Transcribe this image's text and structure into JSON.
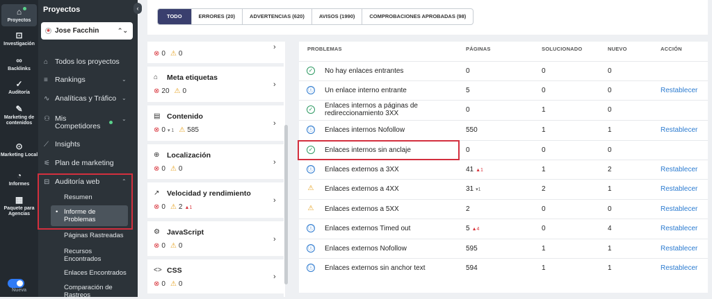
{
  "rail": [
    {
      "label": "Proyectos",
      "icon": "home-icon",
      "glyph": "⌂",
      "active": true
    },
    {
      "label": "Investigación",
      "icon": "research-icon",
      "glyph": "⊡"
    },
    {
      "label": "Backlinks",
      "icon": "link-icon",
      "glyph": "∞"
    },
    {
      "label": "Auditoría",
      "icon": "audit-icon",
      "glyph": "✓"
    },
    {
      "label": "Marketing de contenidos",
      "icon": "edit-icon",
      "glyph": "✎"
    },
    {
      "label": "Marketing Local",
      "icon": "location-icon",
      "glyph": "⊙"
    },
    {
      "label": "Informes",
      "icon": "chart-icon",
      "glyph": "◔"
    },
    {
      "label": "Paquete para Agencias",
      "icon": "building-icon",
      "glyph": "▦"
    },
    {
      "label": "Nueva",
      "icon": "toggle-icon",
      "glyph": ""
    }
  ],
  "sidebar": {
    "title": "Proyectos",
    "project": "Jose Facchin",
    "items": [
      {
        "label": "Todos los proyectos",
        "icon": "folder-icon",
        "glyph": "⌂"
      },
      {
        "label": "Rankings",
        "icon": "rankings-icon",
        "glyph": "≡",
        "caret": "⌄"
      },
      {
        "label": "Analíticas y Tráfico",
        "icon": "analytics-icon",
        "glyph": "∿",
        "caret": "⌄"
      },
      {
        "label": "Mis Competidores",
        "icon": "competitors-icon",
        "glyph": "⚇",
        "caret": "⌄"
      },
      {
        "label": "Insights",
        "icon": "insights-icon",
        "glyph": "⟋"
      },
      {
        "label": "Plan de marketing",
        "icon": "plan-icon",
        "glyph": "⚟"
      },
      {
        "label": "Auditoría web",
        "icon": "webaudit-icon",
        "glyph": "⊟",
        "caret": "⌃"
      }
    ],
    "subitems": [
      "Resumen",
      "Informe de Problemas",
      "Páginas Rastreadas",
      "Recursos Encontrados",
      "Enlaces Encontrados",
      "Comparación de Rastreos"
    ]
  },
  "tabs": [
    "TODO",
    "ERRORES (20)",
    "ADVERTENCIAS (620)",
    "AVISOS (1990)",
    "COMPROBACIONES APROBADAS (98)"
  ],
  "categories": [
    {
      "title": "",
      "icon": "",
      "err": "0",
      "warn": "0"
    },
    {
      "title": "Meta etiquetas",
      "icon": "tag-icon",
      "glyph": "⌂",
      "err": "20",
      "warn": "0"
    },
    {
      "title": "Contenido",
      "icon": "document-icon",
      "glyph": "▤",
      "err": "0",
      "errtrend": "▾ 1",
      "warn": "585"
    },
    {
      "title": "Localización",
      "icon": "globe-icon",
      "glyph": "⊕",
      "err": "0",
      "warn": "0"
    },
    {
      "title": "Velocidad y rendimiento",
      "icon": "speed-icon",
      "glyph": "↗",
      "err": "0",
      "warn": "2",
      "warntrend": "▲1"
    },
    {
      "title": "JavaScript",
      "icon": "javascript-icon",
      "glyph": "⚙",
      "err": "0",
      "warn": "0"
    },
    {
      "title": "CSS",
      "icon": "code-icon",
      "glyph": "<>",
      "err": "0",
      "warn": "0"
    }
  ],
  "table": {
    "headers": [
      "PROBLEMAS",
      "PÁGINAS",
      "SOLUCIONADO",
      "NUEVO",
      "ACCIÓN"
    ],
    "rows": [
      {
        "type": "ok",
        "name": "No hay enlaces entrantes",
        "pages": "0",
        "fixed": "0",
        "new": "0",
        "action": ""
      },
      {
        "type": "info",
        "name": "Un enlace interno entrante",
        "pages": "5",
        "fixed": "0",
        "new": "0",
        "action": "Restablecer"
      },
      {
        "type": "ok",
        "name": "Enlaces internos a páginas de redireccionamiento 3XX",
        "pages": "0",
        "fixed": "1",
        "new": "0",
        "action": ""
      },
      {
        "type": "info",
        "name": "Enlaces internos Nofollow",
        "pages": "550",
        "fixed": "1",
        "new": "1",
        "action": "Restablecer"
      },
      {
        "type": "ok",
        "name": "Enlaces internos sin anclaje",
        "pages": "0",
        "fixed": "0",
        "new": "0",
        "action": ""
      },
      {
        "type": "info",
        "name": "Enlaces externos a 3XX",
        "pages": "41",
        "trend": "▲1",
        "trendDir": "up",
        "fixed": "1",
        "new": "2",
        "action": "Restablecer"
      },
      {
        "type": "warn",
        "name": "Enlaces externos a 4XX",
        "pages": "31",
        "trend": "▾1",
        "trendDir": "dn",
        "fixed": "2",
        "new": "1",
        "action": "Restablecer"
      },
      {
        "type": "warn",
        "name": "Enlaces externos a 5XX",
        "pages": "2",
        "fixed": "0",
        "new": "0",
        "action": "Restablecer"
      },
      {
        "type": "info",
        "name": "Enlaces externos Timed out",
        "pages": "5",
        "trend": "▲4",
        "trendDir": "up",
        "fixed": "0",
        "new": "4",
        "action": "Restablecer"
      },
      {
        "type": "info",
        "name": "Enlaces externos Nofollow",
        "pages": "595",
        "fixed": "1",
        "new": "1",
        "action": "Restablecer"
      },
      {
        "type": "info",
        "name": "Enlaces externos sin anchor text",
        "pages": "594",
        "fixed": "1",
        "new": "1",
        "action": "Restablecer"
      }
    ]
  }
}
